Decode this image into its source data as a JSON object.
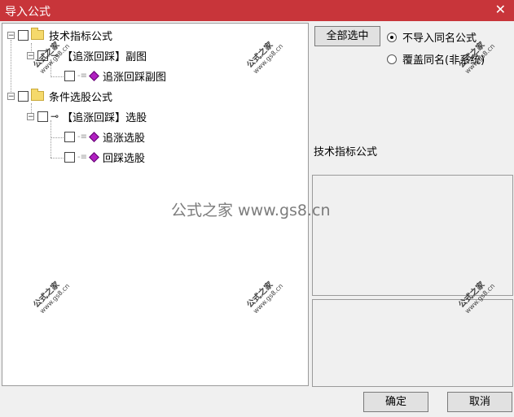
{
  "window": {
    "title": "导入公式",
    "close_glyph": "✕"
  },
  "tree": {
    "nodes": [
      {
        "label": "技术指标公式"
      },
      {
        "label": "【追涨回踩】副图"
      },
      {
        "label": "追涨回踩副图"
      },
      {
        "label": "条件选股公式"
      },
      {
        "label": "【追涨回踩】选股"
      },
      {
        "label": "追涨选股"
      },
      {
        "label": "回踩选股"
      }
    ],
    "expander_glyph": "−"
  },
  "right": {
    "select_all": "全部选中",
    "radio_skip": "不导入同名公式",
    "radio_overwrite": "覆盖同名(非系统)",
    "category_label": "技术指标公式"
  },
  "footer": {
    "ok": "确定",
    "cancel": "取消"
  },
  "watermark": {
    "main": "公式之家",
    "url": "www.gs8.cn",
    "center": "公式之家 www.gs8.cn"
  },
  "colors": {
    "titlebar": "#c8353a",
    "gem": "#b020c0",
    "folder": "#f5d96b"
  }
}
